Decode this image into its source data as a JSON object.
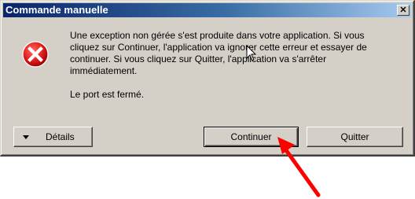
{
  "window": {
    "title": "Commande manuelle",
    "close_glyph": "✕"
  },
  "message": {
    "body": "Une exception non gérée s'est produite dans votre application. Si vous cliquez sur Continuer, l'application va ignorer cette erreur et essayer de continuer. Si vous cliquez sur Quitter, l'application va s'arrêter immédiatement.",
    "detail": "Le port est fermé."
  },
  "buttons": {
    "details_label": "Détails",
    "continue_label": "Continuer",
    "quit_label": "Quitter"
  },
  "icons": {
    "error": "error-icon",
    "dropdown": "triangle-down-icon",
    "annotation": "red-arrow-annotation"
  },
  "colors": {
    "titlebar_start": "#0a246a",
    "titlebar_end": "#a6caf0",
    "dialog_bg": "#d4d0c8",
    "error_red": "#e02020",
    "arrow_red": "#ff0000"
  }
}
